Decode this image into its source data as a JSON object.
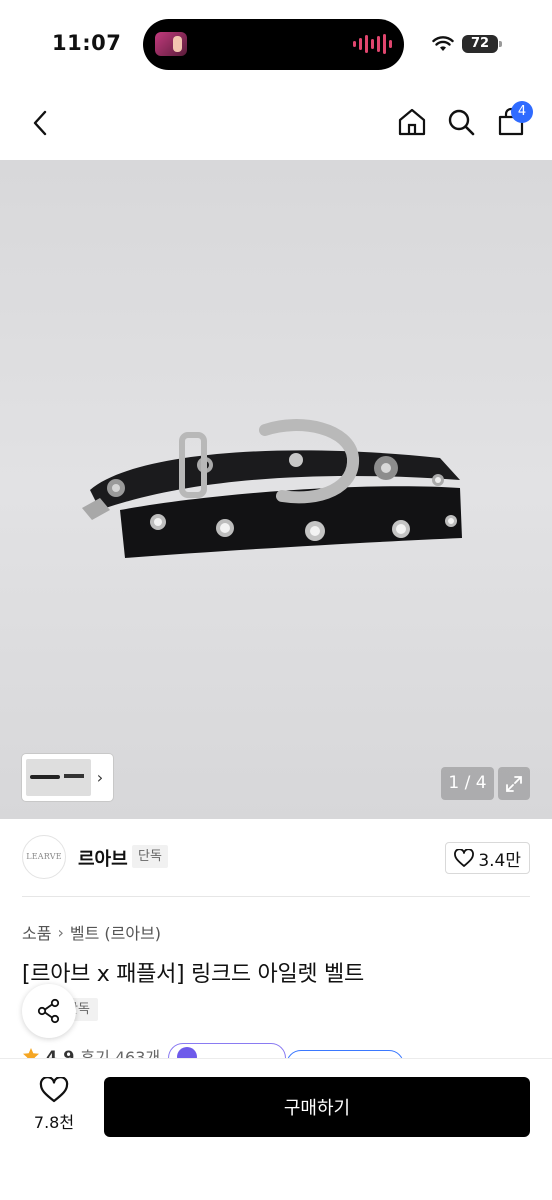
{
  "status_bar": {
    "time": "11:07",
    "battery": "72",
    "wifi_icon": "wifi-icon",
    "island_icon": "now-playing-icon"
  },
  "nav": {
    "back_icon": "chevron-left-icon",
    "home_icon": "home-icon",
    "search_icon": "search-icon",
    "cart_icon": "shopping-bag-icon",
    "cart_badge": "4",
    "badge_color": "#2f6bff"
  },
  "gallery": {
    "counter": "1 / 4",
    "expand_icon": "expand-icon",
    "thumb_more_icon": "chevron-right-icon"
  },
  "brand": {
    "logo_text": "LEARVE",
    "name": "르아브",
    "tag": "단독",
    "like_icon": "heart-icon",
    "like_count": "3.4만"
  },
  "product": {
    "breadcrumb": [
      "소품",
      "벨트 (르아브)"
    ],
    "title": "[르아브 x 패플서] 링크드 아일렛 벨트",
    "exclusive_tag": "단독",
    "share_icon": "share-icon",
    "rating_icon": "star-icon",
    "rating": "4.9",
    "review_count": "후기 463개"
  },
  "bottom_bar": {
    "wish_icon": "heart-icon",
    "wish_count": "7.8천",
    "buy_label": "구매하기",
    "buy_color": "#000000"
  }
}
